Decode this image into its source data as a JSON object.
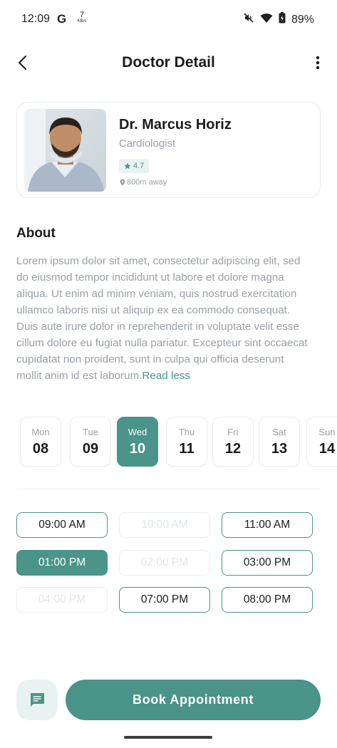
{
  "status_bar": {
    "time": "12:09",
    "g_label": "G",
    "net_speed_value": "7",
    "net_speed_unit": "KB/s",
    "battery_percent": "89%"
  },
  "app_bar": {
    "title": "Doctor Detail"
  },
  "doctor": {
    "name": "Dr. Marcus Horiz",
    "specialty": "Cardiologist",
    "rating": "4.7",
    "distance": "800m away"
  },
  "about": {
    "title": "About",
    "text": "Lorem ipsum dolor sit amet, consectetur adipiscing elit, sed do eiusmod tempor incididunt ut labore et dolore magna aliqua. Ut enim ad minim veniam, quis nostrud exercitation ullamco laboris nisi ut aliquip ex ea commodo consequat. Duis aute irure dolor in reprehenderit in voluptate velit esse cillum dolore eu fugiat nulla pariatur. Excepteur sint occaecat cupidatat non proident, sunt in culpa qui officia deserunt mollit anim id est laborum.",
    "toggle_label": "Read less"
  },
  "days": [
    {
      "name": "Mon",
      "date": "08",
      "selected": false
    },
    {
      "name": "Tue",
      "date": "09",
      "selected": false
    },
    {
      "name": "Wed",
      "date": "10",
      "selected": true
    },
    {
      "name": "Thu",
      "date": "11",
      "selected": false
    },
    {
      "name": "Fri",
      "date": "12",
      "selected": false
    },
    {
      "name": "Sat",
      "date": "13",
      "selected": false
    },
    {
      "name": "Sun",
      "date": "14",
      "selected": false
    }
  ],
  "time_slots": [
    {
      "label": "09:00 AM",
      "state": "available"
    },
    {
      "label": "10:00 AM",
      "state": "disabled"
    },
    {
      "label": "11:00 AM",
      "state": "available"
    },
    {
      "label": "01:00 PM",
      "state": "selected"
    },
    {
      "label": "02:00 PM",
      "state": "disabled"
    },
    {
      "label": "03:00 PM",
      "state": "available"
    },
    {
      "label": "04:00 PM",
      "state": "disabled"
    },
    {
      "label": "07:00 PM",
      "state": "available"
    },
    {
      "label": "08:00 PM",
      "state": "available"
    }
  ],
  "actions": {
    "book_label": "Book Appointment"
  },
  "colors": {
    "accent": "#4a9489",
    "accent_light": "#e8f2f1",
    "muted_text": "#9aa0a6"
  },
  "icons": [
    "back-arrow-icon",
    "more-vert-icon",
    "star-icon",
    "location-pin-icon",
    "chat-icon",
    "mute-icon",
    "wifi-icon",
    "battery-icon"
  ]
}
